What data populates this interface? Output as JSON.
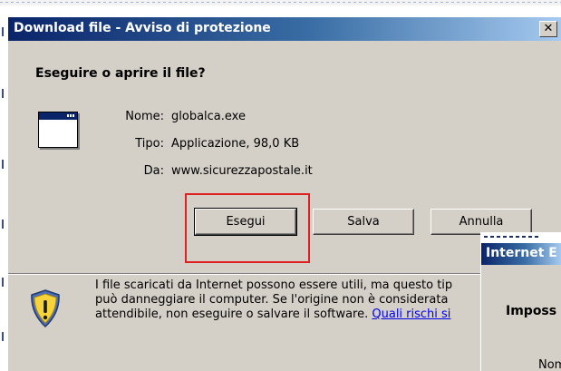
{
  "dialog": {
    "title": "Download file - Avviso di protezione",
    "close_label": "✕",
    "question": "Eseguire o aprire il file?",
    "fields": [
      {
        "label": "Nome:",
        "value": "globalca.exe"
      },
      {
        "label": "Tipo:",
        "value": "Applicazione, 98,0 KB"
      },
      {
        "label": "Da:",
        "value": "www.sicurezzapostale.it"
      }
    ],
    "buttons": {
      "run": "Esegui",
      "save": "Salva",
      "cancel": "Annulla"
    },
    "warning": {
      "line1": "I file scaricati da Internet possono essere utili, ma questo tip",
      "line2": "può danneggiare il computer. Se l'origine non è considerata",
      "line3_prefix": "attendibile, non eseguire o salvare il software. ",
      "link": "Quali rischi si"
    }
  },
  "secondary_dialog": {
    "title": "Internet E",
    "heading": "Imposs",
    "name_fragment": "Nom"
  },
  "colors": {
    "titlebar_start": "#0a246a",
    "titlebar_end": "#a6caf0",
    "highlight": "#e02020",
    "link": "#0000ee"
  },
  "icons": [
    "application-window-icon",
    "security-shield-icon",
    "close-icon"
  ]
}
